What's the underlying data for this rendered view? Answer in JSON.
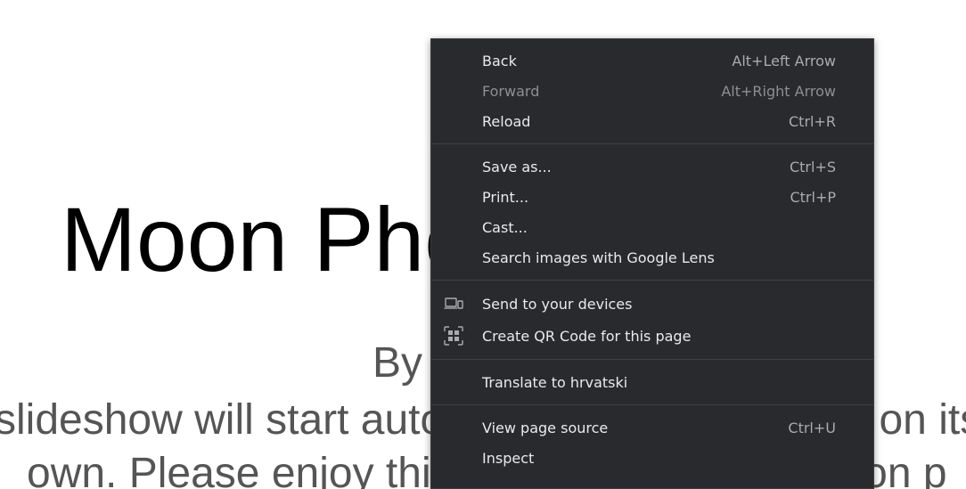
{
  "page": {
    "title": "Moon Photo Project",
    "byline": "By",
    "description_line_1": "slideshow will start automatically and advance on its",
    "description_line_2": "own. Please enjoy this excellent show of moon p"
  },
  "context_menu": {
    "items": [
      {
        "label": "Back",
        "shortcut": "Alt+Left Arrow",
        "enabled": true
      },
      {
        "label": "Forward",
        "shortcut": "Alt+Right Arrow",
        "enabled": false
      },
      {
        "label": "Reload",
        "shortcut": "Ctrl+R",
        "enabled": true
      },
      {
        "label": "Save as...",
        "shortcut": "Ctrl+S",
        "enabled": true
      },
      {
        "label": "Print...",
        "shortcut": "Ctrl+P",
        "enabled": true
      },
      {
        "label": "Cast...",
        "shortcut": "",
        "enabled": true
      },
      {
        "label": "Search images with Google Lens",
        "shortcut": "",
        "enabled": true
      },
      {
        "label": "Send to your devices",
        "shortcut": "",
        "enabled": true,
        "icon": "devices-icon"
      },
      {
        "label": "Create QR Code for this page",
        "shortcut": "",
        "enabled": true,
        "icon": "qr-code-icon"
      },
      {
        "label": "Translate to hrvatski",
        "shortcut": "",
        "enabled": true
      },
      {
        "label": "View page source",
        "shortcut": "Ctrl+U",
        "enabled": true
      },
      {
        "label": "Inspect",
        "shortcut": "",
        "enabled": true
      }
    ]
  },
  "colors": {
    "menu_background": "#292a2d",
    "menu_text": "#e8eaed",
    "menu_disabled_text": "#8e8f92",
    "page_title": "#000000",
    "page_text": "#555555"
  }
}
